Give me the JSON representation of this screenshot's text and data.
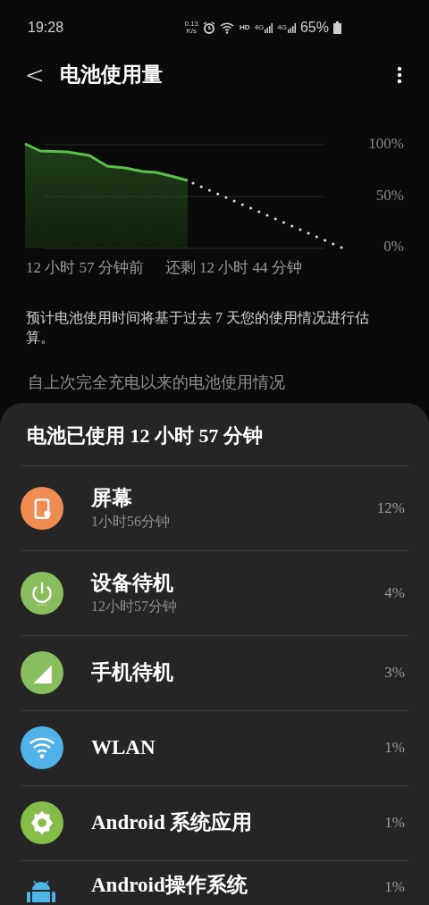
{
  "status_bar": {
    "time": "19:28",
    "speed_value": "0.13",
    "speed_unit": "K/s",
    "hd": "HD",
    "network_1": "4G",
    "network_2": "4G",
    "battery": "65%"
  },
  "app_bar": {
    "back": "<",
    "title": "电池使用量"
  },
  "usage_chart": {
    "y_labels": [
      "100%",
      "50%",
      "0%"
    ],
    "start_label": "12 小时 57 分钟前",
    "end_label": "还剩 12 小时 44 分钟"
  },
  "note": "预计电池使用时间将基于过去 7 天您的使用情况进行估算。",
  "section_header": "自上次完全充电以来的电池使用情况",
  "usage_sheet": {
    "title": "电池已使用 12 小时 57 分钟",
    "items": [
      {
        "kind": "screen",
        "color": "#ef8c52",
        "name": "屏幕",
        "duration": "1小时56分钟",
        "percent": "12%"
      },
      {
        "kind": "power",
        "color": "#88be5e",
        "name": "设备待机",
        "duration": "12小时57分钟",
        "percent": "4%"
      },
      {
        "kind": "signal",
        "color": "#88be5e",
        "name": "手机待机",
        "percent": "3%"
      },
      {
        "kind": "wifi",
        "color": "#50b2e8",
        "name": "WLAN",
        "percent": "1%"
      },
      {
        "kind": "gear",
        "color": "#86bd48",
        "name": "Android 系统应用",
        "percent": "1%"
      },
      {
        "kind": "android",
        "color": "#4cb6e6",
        "name": "Android操作系统",
        "percent": "1%"
      }
    ]
  }
}
